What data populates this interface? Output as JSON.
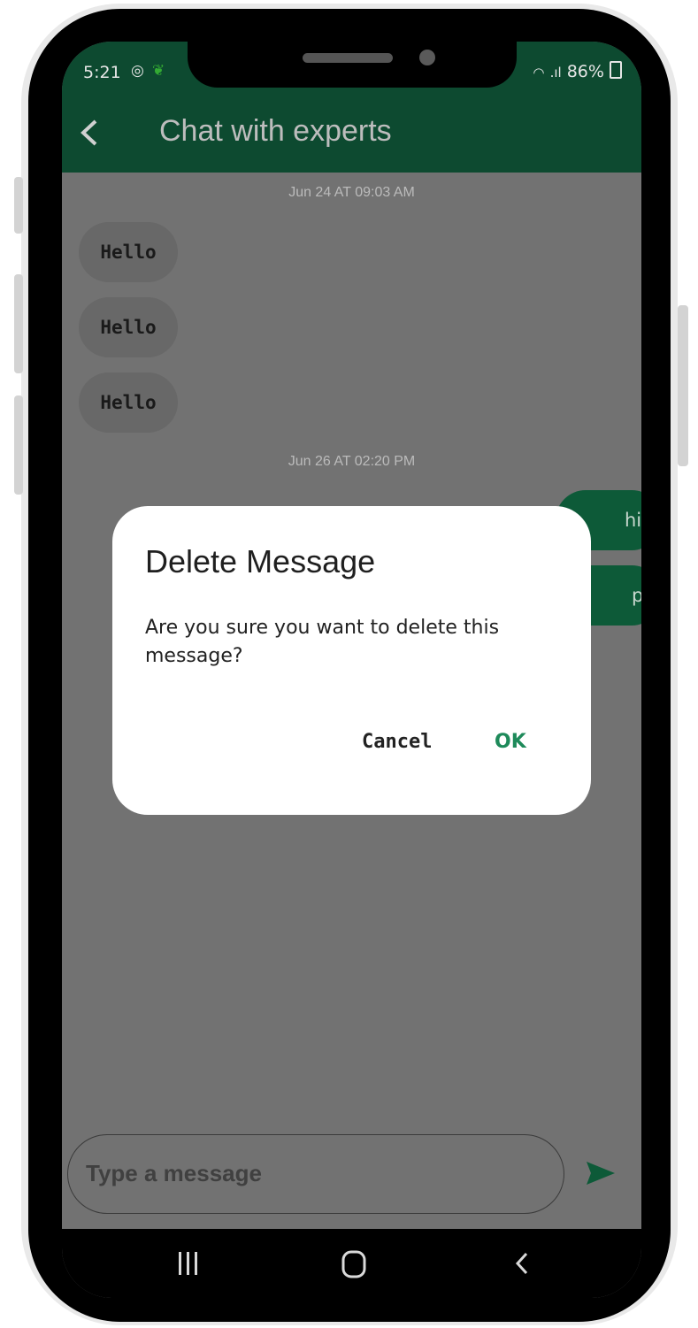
{
  "status_bar": {
    "time": "5:21",
    "battery": "86%"
  },
  "app_bar": {
    "title": "Chat with experts"
  },
  "chat": {
    "date_1": "Jun 24 AT 09:03 AM",
    "messages_received": [
      "Hello",
      "Hello",
      "Hello"
    ],
    "date_2": "Jun 26 AT 02:20 PM",
    "messages_sent": [
      "hii",
      "p"
    ]
  },
  "dialog": {
    "title": "Delete Message",
    "message": "Are you sure you want to delete this message?",
    "cancel_label": "Cancel",
    "ok_label": "OK"
  },
  "composer": {
    "placeholder": "Type a message"
  },
  "colors": {
    "primary": "#0d4a30",
    "accent": "#1e8a5a",
    "overlay": "#727272"
  }
}
